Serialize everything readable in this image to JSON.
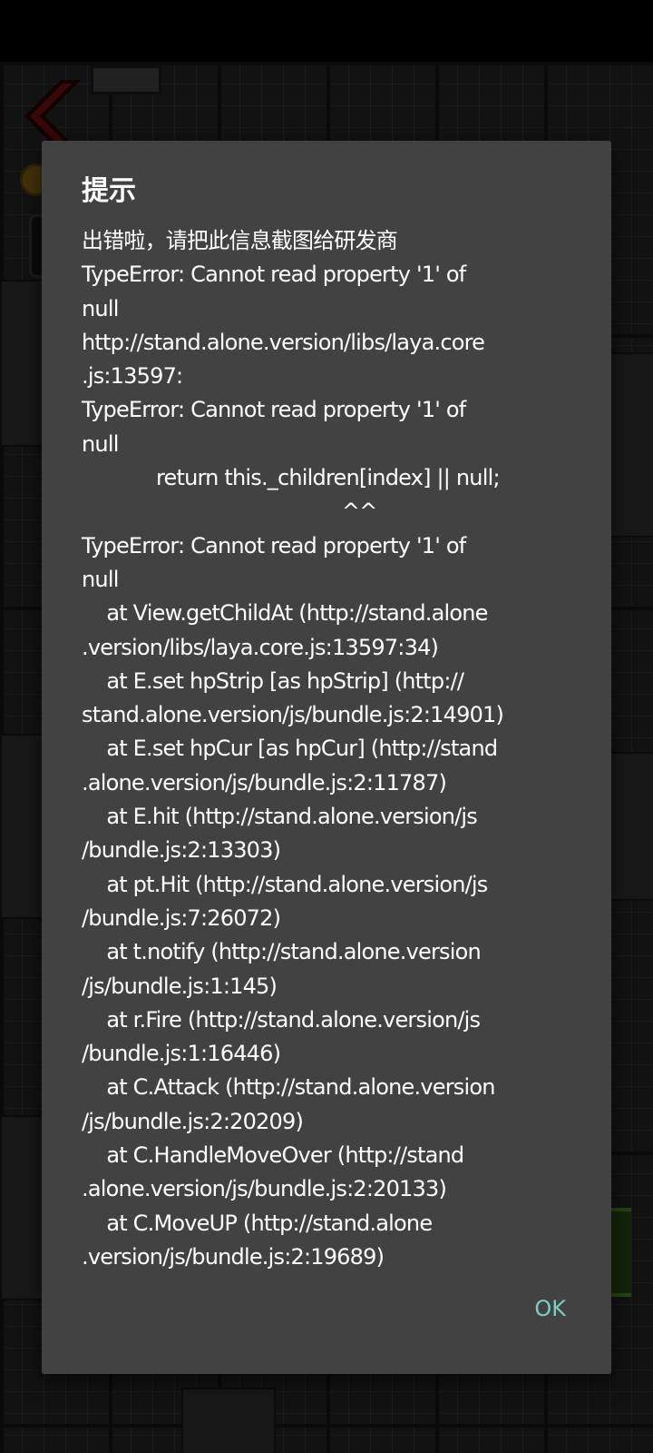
{
  "dialog": {
    "title": "提示",
    "message_lines": [
      "出错啦，请把此信息截图给研发商",
      "TypeError: Cannot read property '1' of",
      "null",
      "http://stand.alone.version/libs/laya.core",
      ".js:13597:",
      "TypeError: Cannot read property '1' of",
      "null",
      "            return this._children[index] || null;",
      "                                          ^^",
      "TypeError: Cannot read property '1' of",
      "null",
      "    at View.getChildAt (http://stand.alone",
      ".version/libs/laya.core.js:13597:34)",
      "    at E.set hpStrip [as hpStrip] (http://",
      "stand.alone.version/js/bundle.js:2:14901)",
      "    at E.set hpCur [as hpCur] (http://stand",
      ".alone.version/js/bundle.js:2:11787)",
      "    at E.hit (http://stand.alone.version/js",
      "/bundle.js:2:13303)",
      "    at pt.Hit (http://stand.alone.version/js",
      "/bundle.js:7:26072)",
      "    at t.notify (http://stand.alone.version",
      "/js/bundle.js:1:145)",
      "    at r.Fire (http://stand.alone.version/js",
      "/bundle.js:1:16446)",
      "    at C.Attack (http://stand.alone.version",
      "/js/bundle.js:2:20209)",
      "    at C.HandleMoveOver (http://stand",
      ".alone.version/js/bundle.js:2:20133)",
      "    at C.MoveUP (http://stand.alone",
      ".version/js/bundle.js:2:19689)"
    ],
    "ok_label": "OK"
  },
  "colors": {
    "dialog_bg": "#424242",
    "text": "#ffffff",
    "accent": "#80cbc4"
  },
  "icons": {
    "back": "back-arrow-icon",
    "coin": "coin-icon"
  }
}
